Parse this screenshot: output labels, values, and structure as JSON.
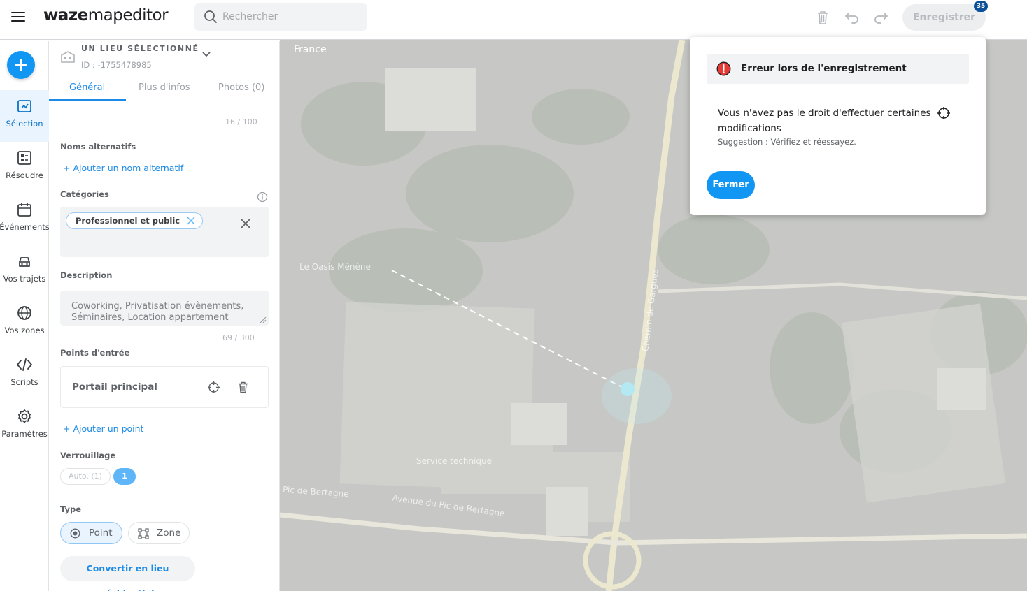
{
  "app": {
    "logo_bold": "waze",
    "logo_rest": "mapeditor"
  },
  "search": {
    "placeholder": "Rechercher"
  },
  "toolbar": {
    "save_label": "Enregistrer",
    "save_badge": "35",
    "icons": [
      "trash-icon",
      "undo-icon",
      "redo-icon"
    ]
  },
  "nav": {
    "items": [
      {
        "label": "Sélection",
        "icon": "selection-icon",
        "active": true
      },
      {
        "label": "Résoudre",
        "icon": "resolve-icon"
      },
      {
        "label": "Événements",
        "icon": "calendar-icon"
      },
      {
        "label": "Vos trajets",
        "icon": "car-icon"
      },
      {
        "label": "Vos zones",
        "icon": "globe-icon"
      },
      {
        "label": "Scripts",
        "icon": "code-icon"
      },
      {
        "label": "Paramètres",
        "icon": "gear-icon"
      }
    ]
  },
  "panel": {
    "title": "UN LIEU SÉLECTIONNÉ",
    "id": "ID : -1755478985",
    "tabs": [
      "Général",
      "Plus d'infos",
      "Photos (0)"
    ],
    "name_counter": "16 / 100",
    "alt_names_label": "Noms alternatifs",
    "add_alt_name": "+ Ajouter un nom alternatif",
    "categories_label": "Catégories",
    "category_chip": "Professionnel et public",
    "description_label": "Description",
    "description_value": "Coworking, Privatisation évènements, Séminaires, Location appartement",
    "description_counter": "69 / 300",
    "entry_points_label": "Points d'entrée",
    "entry_point_name": "Portail principal",
    "add_point": "+ Ajouter un point",
    "lock_label": "Verrouillage",
    "lock_auto": "Auto. (1)",
    "lock_value": "1",
    "type_label": "Type",
    "type_point": "Point",
    "type_zone": "Zone",
    "convert_button": "Convertir en lieu résidentiel"
  },
  "map": {
    "country": "France",
    "labels": [
      "Le Oasis Ménène",
      "Service technique",
      "Avenue du Pic de Bertagne",
      "Pic de Bertagne",
      "Chemin de Gargues"
    ]
  },
  "dialog": {
    "title": "Erreur lors de l'enregistrement",
    "message": "Vous n'avez pas le droit d'effectuer certaines modifications",
    "suggestion": "Suggestion : Vérifiez et réessayez.",
    "close_label": "Fermer",
    "error_color": "#e53935"
  },
  "colors": {
    "accent": "#1296f3",
    "link": "#1c8ae6",
    "badge": "#0b4f9a"
  }
}
